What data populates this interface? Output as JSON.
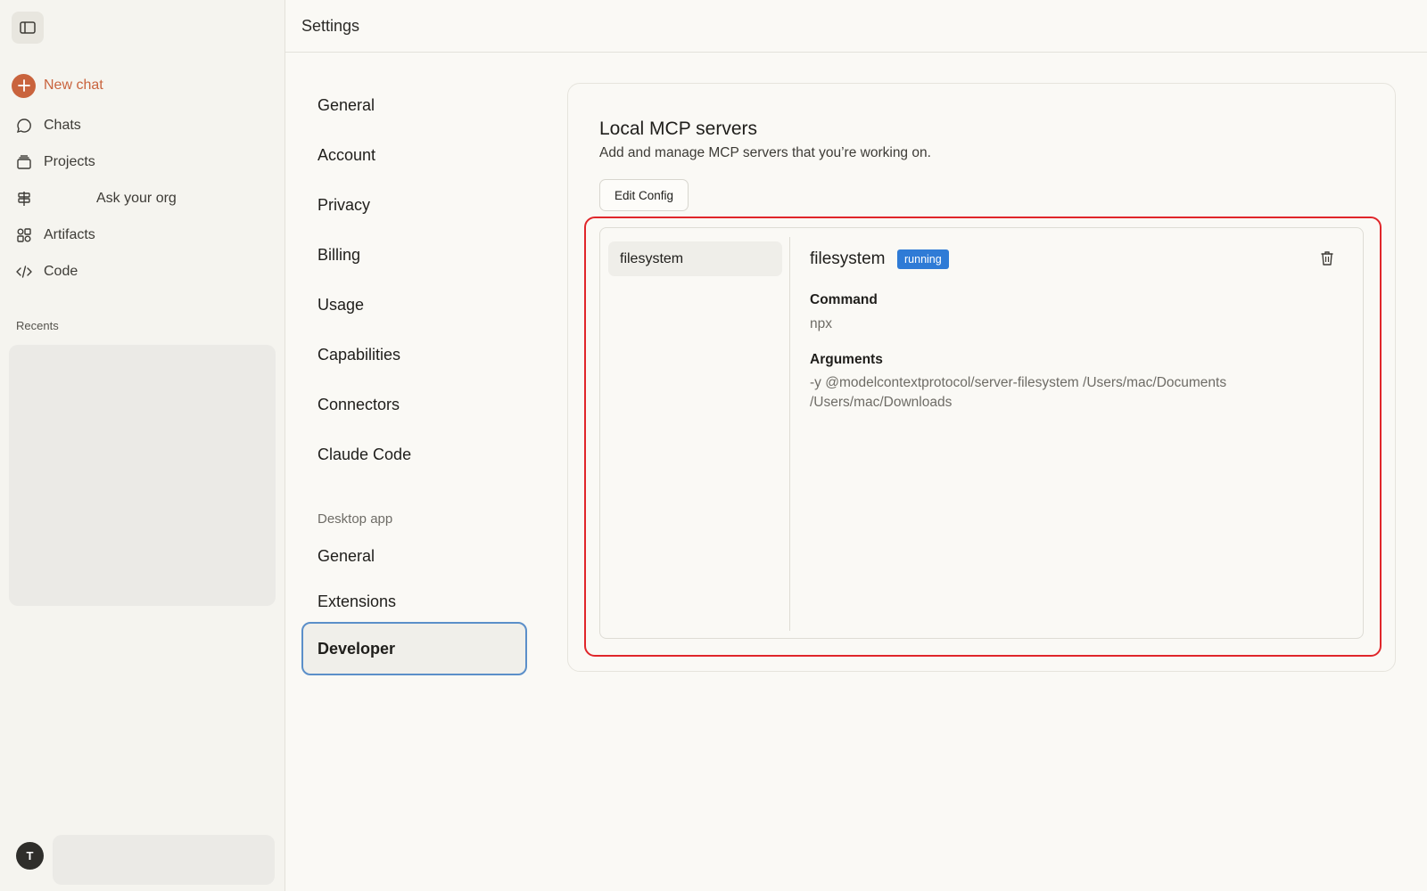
{
  "sidebar": {
    "new_chat": "New chat",
    "items": [
      {
        "label": "Chats",
        "icon": "chat-bubble-icon"
      },
      {
        "label": "Projects",
        "icon": "folder-stack-icon"
      },
      {
        "label": "Ask your org",
        "icon": "signpost-icon"
      },
      {
        "label": "Artifacts",
        "icon": "grid-shapes-icon"
      },
      {
        "label": "Code",
        "icon": "code-brackets-icon"
      }
    ],
    "recents_label": "Recents",
    "avatar_initial": "T"
  },
  "header": {
    "title": "Settings"
  },
  "settings_nav": {
    "items": [
      "General",
      "Account",
      "Privacy",
      "Billing",
      "Usage",
      "Capabilities",
      "Connectors",
      "Claude Code"
    ],
    "desktop_section": "Desktop app",
    "desktop_items": [
      "General",
      "Extensions",
      "Developer"
    ],
    "active": "Developer"
  },
  "mcp": {
    "title": "Local MCP servers",
    "subtitle": "Add and manage MCP servers that you’re working on.",
    "edit_button": "Edit Config",
    "servers": [
      {
        "name": "filesystem"
      }
    ],
    "selected": {
      "name": "filesystem",
      "status": "running",
      "command_label": "Command",
      "command": "npx",
      "arguments_label": "Arguments",
      "arguments": "-y @modelcontextprotocol/server-filesystem /Users/mac/Documents /Users/mac/Downloads"
    }
  },
  "colors": {
    "accent": "#c9633d",
    "status_running": "#2f7bd6",
    "highlight": "#e0262a",
    "active_border": "#5b8fc9"
  }
}
